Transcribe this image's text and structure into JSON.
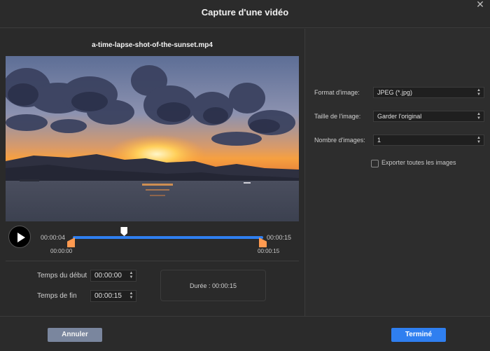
{
  "dialog": {
    "title": "Capture d'une vidéo",
    "close_icon": "close-icon"
  },
  "video": {
    "filename": "a-time-lapse-shot-of-the-sunset.mp4",
    "current_time": "00:00:04",
    "total_time": "00:00:15",
    "range_start_label": "00:00:00",
    "range_end_label": "00:00:15",
    "playhead_fraction": 0.27,
    "play_icon": "play-icon"
  },
  "trim": {
    "start_label": "Temps du début",
    "start_value": "00:00:00",
    "end_label": "Temps de fin",
    "end_value": "00:00:15",
    "duration_text": "Durée : 00:00:15"
  },
  "settings": {
    "format_label": "Format d'image:",
    "format_value": "JPEG (*.jpg)",
    "size_label": "Taille de l'image:",
    "size_value": "Garder l'original",
    "count_label": "Nombre d'images:",
    "count_value": "1",
    "export_all_label": "Exporter toutes les images",
    "export_all_checked": false
  },
  "footer": {
    "cancel_label": "Annuler",
    "done_label": "Terminé"
  },
  "colors": {
    "accent": "#2f7ff0",
    "handle": "#ff9a50",
    "cancel": "#7a869e"
  }
}
